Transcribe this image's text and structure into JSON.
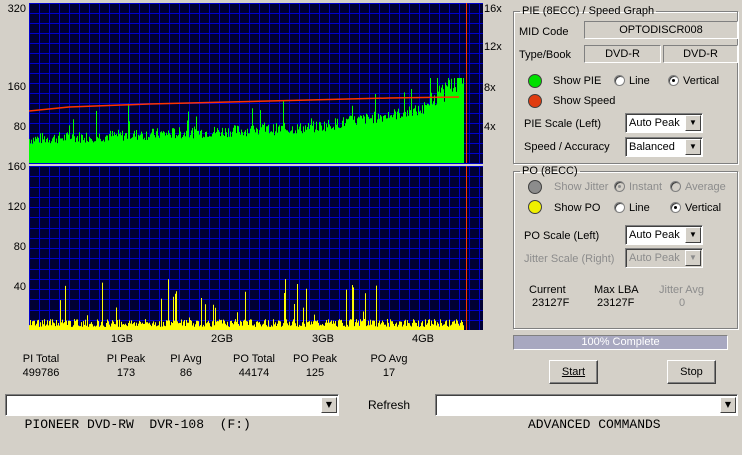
{
  "pie_graph": {
    "y_ticks": [
      "320",
      "160",
      "80"
    ],
    "speed_ticks": [
      "16x",
      "12x",
      "8x",
      "4x"
    ]
  },
  "po_graph": {
    "y_ticks": [
      "160",
      "120",
      "80",
      "40"
    ],
    "x_ticks": [
      "1GB",
      "2GB",
      "3GB",
      "4GB"
    ]
  },
  "colors": {
    "background": "#000033",
    "grid": "#0000cc",
    "pie": "#00ff00",
    "speed": "#ff3300",
    "po": "#ffff00"
  },
  "stats": [
    {
      "label": "PI Total",
      "value": "499786"
    },
    {
      "label": "PI Peak",
      "value": "173"
    },
    {
      "label": "PI Avg",
      "value": "86"
    },
    {
      "label": "PO Total",
      "value": "44174"
    },
    {
      "label": "PO Peak",
      "value": "125"
    },
    {
      "label": "PO Avg",
      "value": "17"
    }
  ],
  "pie_panel": {
    "legend": "PIE (8ECC) / Speed Graph",
    "mid_code_label": "MID Code",
    "mid_code_value": "OPTODISCR008",
    "type_book_label": "Type/Book",
    "type_value": "DVD-R",
    "book_value": "DVD-R",
    "show_pie_label": "Show PIE",
    "line_label": "Line",
    "vertical_label": "Vertical",
    "show_speed_label": "Show Speed",
    "pie_scale_label": "PIE Scale (Left)",
    "pie_scale_value": "Auto Peak",
    "speed_accuracy_label": "Speed / Accuracy",
    "speed_accuracy_value": "Balanced"
  },
  "po_panel": {
    "legend": "PO (8ECC)",
    "show_jitter_label": "Show Jitter",
    "instant_label": "Instant",
    "average_label": "Average",
    "show_po_label": "Show PO",
    "line_label": "Line",
    "vertical_label": "Vertical",
    "po_scale_label": "PO Scale (Left)",
    "po_scale_value": "Auto Peak",
    "jitter_scale_label": "Jitter Scale (Right)",
    "jitter_scale_value": "Auto Peak",
    "current_label": "Current",
    "current_value": "23127F",
    "max_lba_label": "Max LBA",
    "max_lba_value": "23127F",
    "jitter_avg_label": "Jitter Avg",
    "jitter_avg_value": "0"
  },
  "progress": {
    "text": "100% Complete",
    "fraction": 1.0
  },
  "buttons": {
    "start": "Start",
    "stop": "Stop",
    "refresh": "Refresh"
  },
  "drive_select": "PIONEER DVD-RW  DVR-108  (F:)",
  "commands_select": "ADVANCED COMMANDS"
}
